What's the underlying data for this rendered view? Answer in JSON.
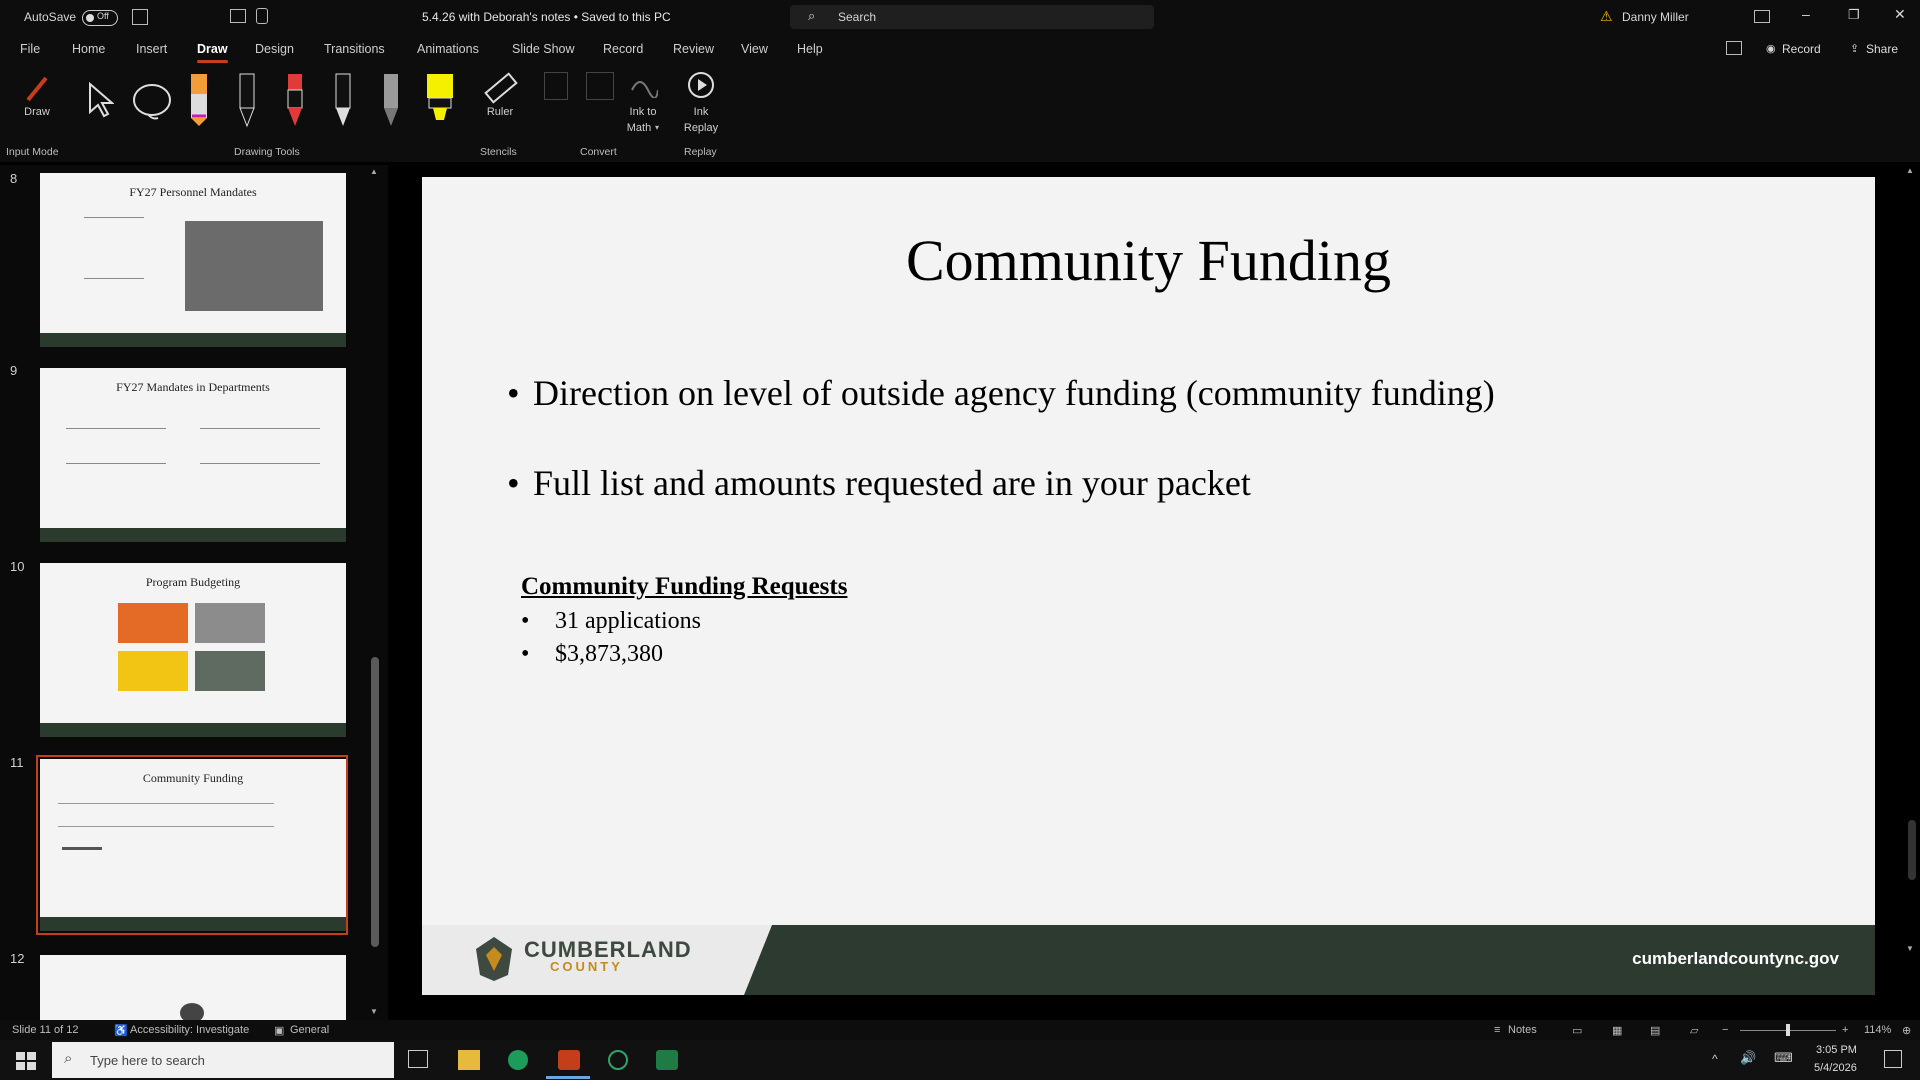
{
  "titlebar": {
    "autosave_label": "AutoSave",
    "autosave_state": "Off",
    "doc_title": "5.4.26 with Deborah's notes • Saved to this PC",
    "search_placeholder": "Search",
    "user_name": "Danny Miller"
  },
  "menu": {
    "items": [
      "File",
      "Home",
      "Insert",
      "Draw",
      "Design",
      "Transitions",
      "Animations",
      "Slide Show",
      "Record",
      "Review",
      "View",
      "Help"
    ],
    "active": "Draw",
    "record_button": "Record",
    "share_button": "Share"
  },
  "ribbon": {
    "draw_label": "Draw",
    "ruler_label": "Ruler",
    "ink_to_math_label_1": "Ink to",
    "ink_to_math_label_2": "Math",
    "ink_replay_label_1": "Ink",
    "ink_replay_label_2": "Replay",
    "groups": {
      "input_mode": "Input Mode",
      "drawing_tools": "Drawing Tools",
      "stencils": "Stencils",
      "convert": "Convert",
      "replay": "Replay"
    },
    "pen_colors": [
      "#f29d38",
      "#ffffff",
      "#e03a3a",
      "#d9d9d9",
      "#cfcfcf",
      "#f5f000"
    ]
  },
  "thumbnails": [
    {
      "number": "8",
      "title": "FY27 Personnel Mandates"
    },
    {
      "number": "9",
      "title": "FY27 Mandates in Departments"
    },
    {
      "number": "10",
      "title": "Program Budgeting"
    },
    {
      "number": "11",
      "title": "Community Funding"
    },
    {
      "number": "12",
      "title": ""
    }
  ],
  "slide": {
    "title": "Community Funding",
    "bullets": [
      "Direction on level of outside agency funding (community funding)",
      "Full list and amounts requested are in your packet"
    ],
    "requests_title": "Community Funding Requests",
    "requests": [
      "31 applications",
      "$3,873,380"
    ],
    "footer_brand": "CUMBERLAND",
    "footer_brand_sub": "COUNTY",
    "footer_url": "cumberlandcountync.gov"
  },
  "statusbar": {
    "slide_info": "Slide 11 of 12",
    "accessibility": "Accessibility: Investigate",
    "sensitivity": "General",
    "notes": "Notes",
    "zoom": "114%"
  },
  "taskbar": {
    "search_placeholder": "Type here to search",
    "time": "3:05 PM",
    "date": "5/4/2026"
  }
}
